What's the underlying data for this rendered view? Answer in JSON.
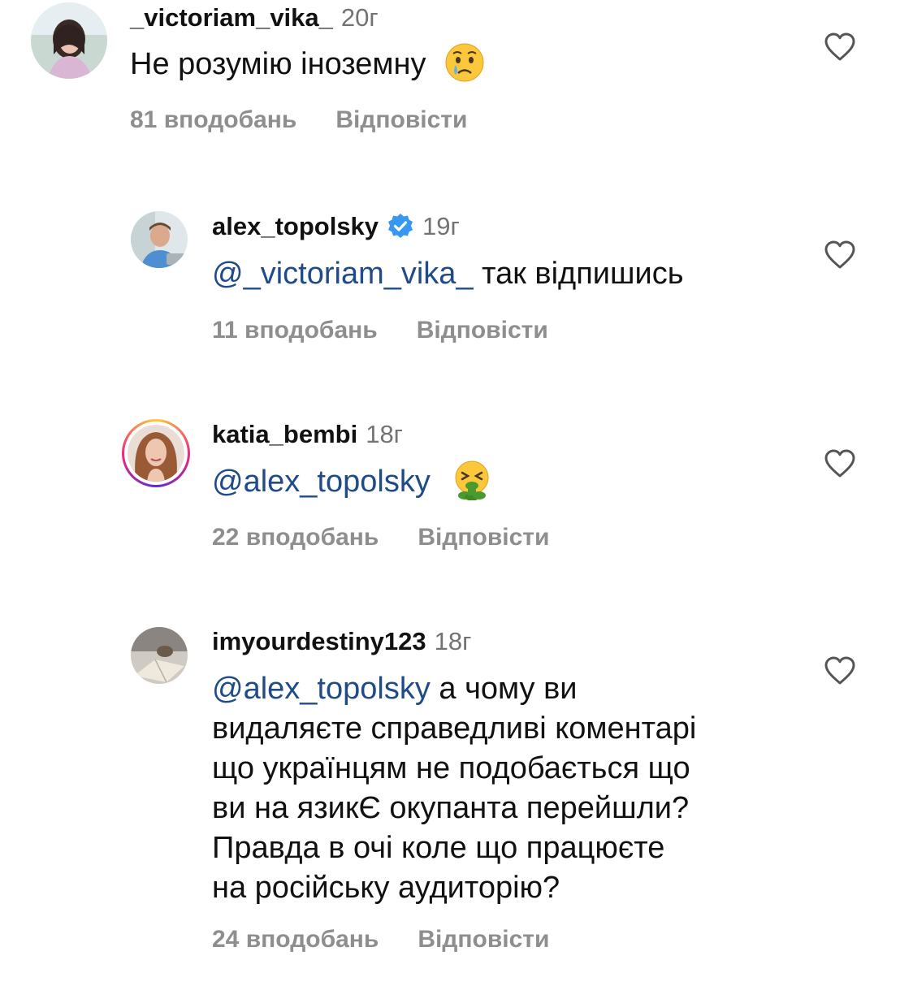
{
  "comments": [
    {
      "username": "_victoriam_vika_",
      "time": "20г",
      "text": "Не розумію іноземну",
      "emoji": "crying-face-emoji",
      "likes": "81 вподобань",
      "reply": "Відповісти"
    },
    {
      "username": "alex_topolsky",
      "verified": true,
      "time": "19г",
      "mention": "@_victoriam_vika_",
      "text": " так відпишись",
      "likes": "11 вподобань",
      "reply": "Відповісти"
    },
    {
      "username": "katia_bembi",
      "time": "18г",
      "mention": "@alex_topolsky",
      "emoji": "vomiting-face-emoji",
      "likes": "22 вподобань",
      "reply": "Відповісти"
    },
    {
      "username": "imyourdestiny123",
      "time": "18г",
      "mention": "@alex_topolsky",
      "text_line1": " а чому ви",
      "text_lines": [
        "видаляєте справедливі коментарі",
        "що українцям не подобається що",
        "ви на язикЄ окупанта перейшли?",
        "Правда в очі коле що працюєте",
        "на російську аудиторію?"
      ],
      "likes": "24 вподобань",
      "reply": "Відповісти"
    }
  ],
  "colors": {
    "mention": "#1f4b8a",
    "muted": "#8e8e8e",
    "verified": "#3897f0"
  }
}
